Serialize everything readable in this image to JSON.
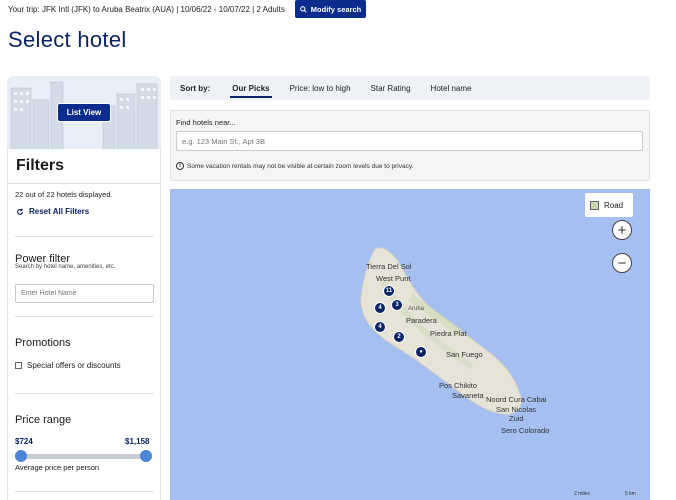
{
  "trip": {
    "summary": "Your trip: JFK Intl (JFK) to Aruba Beatrix (AUA) | 10/06/22 - 10/07/22 | 2 Adults",
    "modify_label": "Modify search"
  },
  "page_title": "Select hotel",
  "sidebar": {
    "list_view_label": "List View",
    "filters_title": "Filters",
    "hotel_count": "22 out of 22 hotels displayed.",
    "reset_label": "Reset All Filters",
    "power_filter": {
      "title": "Power filter",
      "subtitle": "Search by hotel name, amenities, etc.",
      "placeholder": "Enter Hotel Name"
    },
    "promotions": {
      "title": "Promotions",
      "option": "Special offers or discounts"
    },
    "price_range": {
      "title": "Price range",
      "min": "$724",
      "max": "$1,158",
      "note": "Average price per person"
    }
  },
  "sort": {
    "label": "Sort by:",
    "options": [
      "Our Picks",
      "Price: low to high",
      "Star Rating",
      "Hotel name"
    ],
    "active": "Our Picks"
  },
  "find": {
    "label": "Find hotels near...",
    "placeholder": "e.g. 123 Main St., Apt 3B",
    "note": "Some vacation rentals may not be visible at certain zoom levels due to privacy."
  },
  "map": {
    "type_label": "Road",
    "zoom_in": "+",
    "zoom_out": "−",
    "places": [
      "Tierra Del Sol",
      "West Punt",
      "Aruba",
      "Paradera",
      "Piedra Plat",
      "San Fuego",
      "Pos Chikito",
      "Savaneta",
      "Noord Cura Cabai",
      "San Nicolas",
      "Zuid",
      "Sero Colorado"
    ],
    "pins": [
      "11",
      "4",
      "3",
      "4",
      "2",
      "●"
    ],
    "scale": [
      "2 miles",
      "5 km"
    ]
  }
}
